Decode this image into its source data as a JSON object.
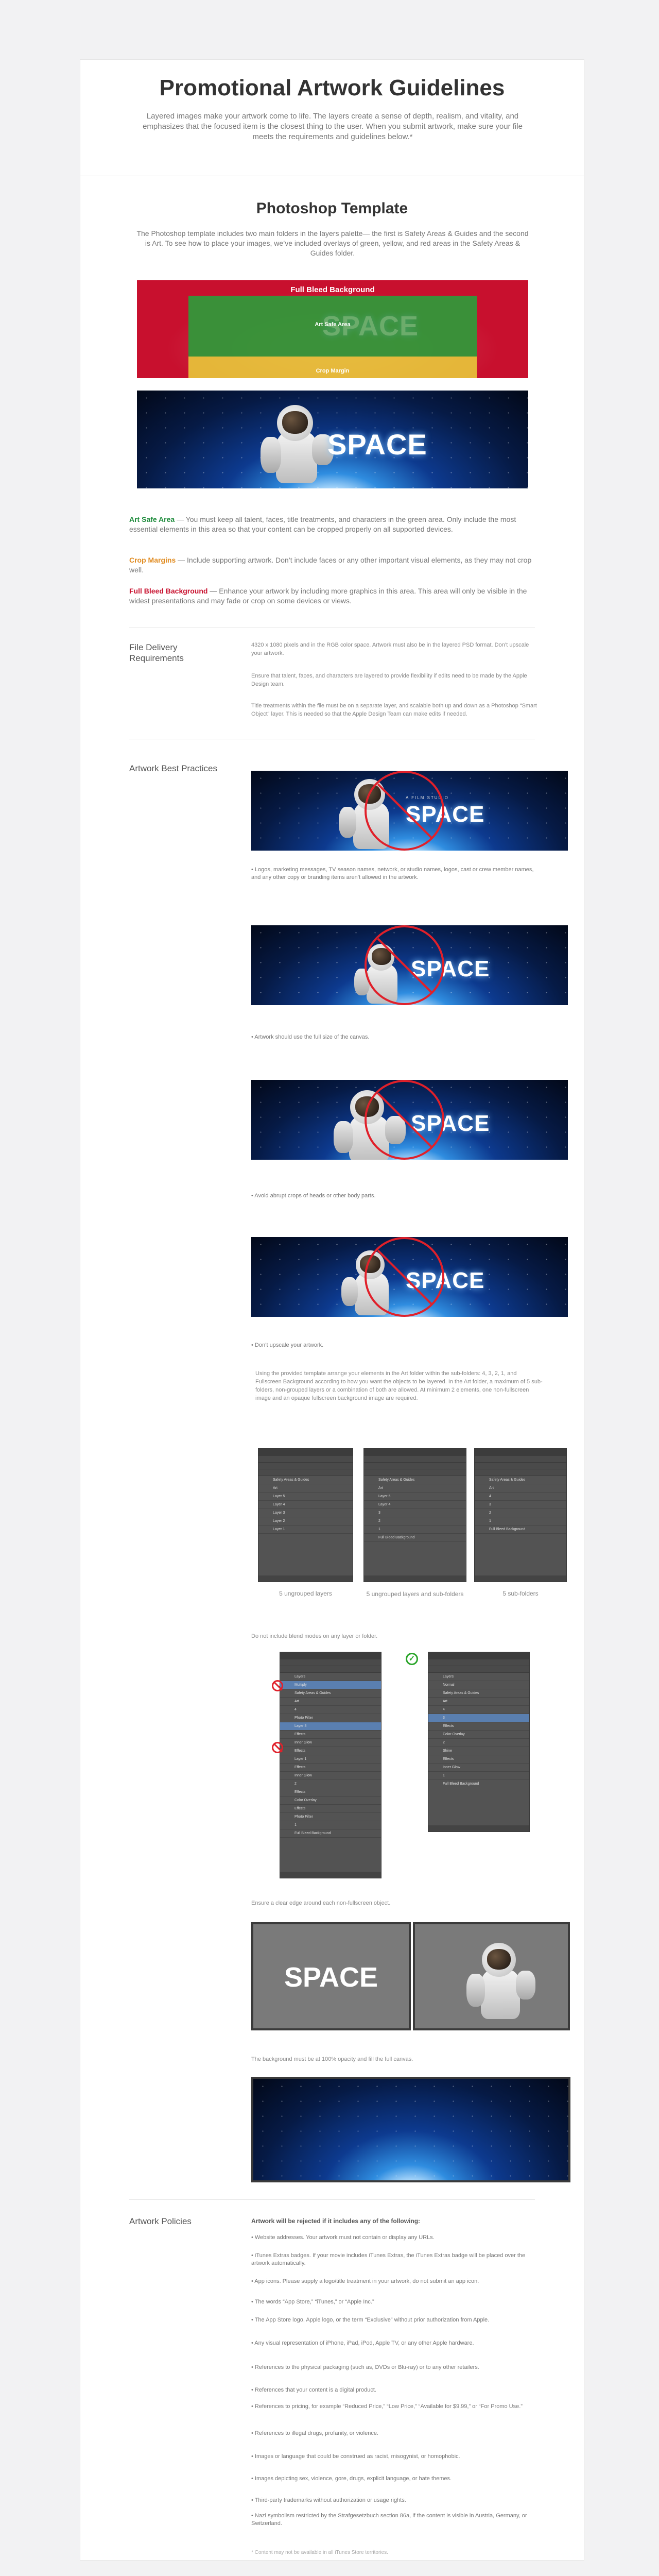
{
  "header": {
    "title": "Promotional Artwork Guidelines",
    "intro": "Layered images make your artwork come to life. The layers create a sense of depth, realism, and vitality, and emphasizes that the focused item is the closest thing to the user. When you submit artwork, make sure your file meets the requirements and guidelines below.*"
  },
  "template": {
    "title": "Photoshop Template",
    "intro": "The Photoshop template includes two main folders in the layers palette— the first is Safety Areas & Guides and the second is Art. To see how to place your images, we’ve included overlays of green, yellow, and red areas in the Safety Areas & Guides folder.",
    "overlay_labels": {
      "full_bleed": "Full Bleed Background",
      "art_safe": "Art Safe Area",
      "crop": "Crop Margin"
    },
    "space_word": "SPACE",
    "colors": {
      "red": "#c8102e",
      "yellow": "#e8c83a",
      "green": "#1c8a3a",
      "orange": "#e08a1e"
    },
    "areas": [
      {
        "name": "Art Safe Area",
        "text": " — You must keep all talent, faces, title treatments, and characters in the green area. Only include the most essential elements in this area so that your content can be cropped properly on all supported devices."
      },
      {
        "name": "Crop Margins",
        "text": " — Include supporting artwork. Don’t include faces or any other important visual elements, as they may not crop well."
      },
      {
        "name": "Full Bleed Background",
        "text": " — Enhance your artwork by including more graphics in this area. This area will only be visible in the widest presentations and may fade or crop on some devices or views."
      }
    ]
  },
  "file_delivery": {
    "title": "File Delivery Requirements",
    "paragraphs": [
      "4320 x 1080 pixels and in the RGB color space. Artwork must also be in the layered PSD format. Don’t upscale your artwork.",
      "Ensure that talent, faces, and characters are layered to provide flexibility if edits need to be made by the Apple Design team.",
      "Title treatments within the file must be on a separate layer, and scalable both up and down as a Photoshop “Smart Object” layer. This is needed so that the Apple Design Team can make edits if needed."
    ]
  },
  "best_practices": {
    "title": "Artwork Best Practices",
    "examples": [
      {
        "subtitle": "A FILM STUDIO",
        "caption": "• Logos, marketing messages, TV season names, network, or studio names, logos, cast or crew member names, and any other copy or branding items aren’t allowed in the artwork."
      },
      {
        "subtitle": "",
        "caption": "• Artwork should use the full size of the canvas."
      },
      {
        "subtitle": "",
        "caption": "• Avoid abrupt crops of heads or other body parts."
      },
      {
        "subtitle": "",
        "caption": "• Don’t upscale your artwork."
      }
    ],
    "layers_text": "Using the provided template arrange your elements in the Art folder within the sub-folders: 4, 3, 2, 1, and Fullscreen Background according to how you want the objects to be layered. In the Art folder, a maximum of 5 sub-folders, non-grouped layers or a combination of both are allowed. At minimum 2 elements, one non-fullscreen image and an opaque fullscreen background image are required.",
    "panels": [
      {
        "caption": "5 ungrouped layers",
        "rows": [
          "Safety Areas & Guides",
          "Art",
          "Layer 5",
          "Layer 4",
          "Layer 3",
          "Layer 2",
          "Layer 1"
        ]
      },
      {
        "caption": "5 ungrouped layers and sub-folders",
        "rows": [
          "Safety Areas & Guides",
          "Art",
          "Layer 5",
          "Layer 4",
          "3",
          "2",
          "1",
          "Full Bleed Background"
        ]
      },
      {
        "caption": "5 sub-folders",
        "rows": [
          "Safety Areas & Guides",
          "Art",
          "4",
          "3",
          "2",
          "1",
          "Full Bleed Background"
        ]
      }
    ],
    "blend_text": "Do not include blend modes on any layer or folder.",
    "blend_panels": {
      "bad_rows": [
        "Layers",
        "Multiply",
        "Safety Areas & Guides",
        "Art",
        "4",
        "Photo Filter",
        "Layer 3",
        "Effects",
        "Inner Glow",
        "Effects",
        "Layer 1",
        "Effects",
        "Inner Glow",
        "2",
        "Effects",
        "Color Overlay",
        "Effects",
        "Photo Filter",
        "1",
        "Full Bleed Background"
      ],
      "good_rows": [
        "Layers",
        "Normal",
        "Safety Areas & Guides",
        "Art",
        "4",
        "3",
        "Effects",
        "Color Overlay",
        "2",
        "Shine",
        "Effects",
        "Inner Glow",
        "1",
        "Full Bleed Background"
      ]
    },
    "clear_edge_text": "Ensure a clear edge around each non-fullscreen object.",
    "clear_edge_word": "SPACE",
    "bg_text": "The background must be at 100% opacity and fill the full canvas."
  },
  "policies": {
    "title": "Artwork Policies",
    "heading": "Artwork will be rejected if it includes any of the following:",
    "items": [
      "• Website addresses. Your artwork must not contain or display any URLs.",
      "• iTunes Extras badges. If your movie includes iTunes Extras, the iTunes Extras badge will be placed over the artwork automatically.",
      "• App icons. Please supply a logo/title treatment in your artwork, do not submit an app icon.",
      "• The words “App Store,” “iTunes,” or “Apple Inc.”",
      "• The App Store logo, Apple logo, or the term “Exclusive” without prior authorization from Apple.",
      "• Any visual representation of iPhone, iPad, iPod, Apple TV, or any other Apple hardware.",
      "• References to the physical packaging (such as, DVDs or Blu-ray) or to any other retailers.",
      "• References that your content is a digital product.",
      "• References to pricing, for example “Reduced Price,” “Low Price,” “Available for $9.99,” or “For Promo Use.”",
      "• References to illegal drugs, profanity, or violence.",
      "• Images or language that could be construed as racist, misogynist, or homophobic.",
      "• Images depicting sex, violence, gore, drugs, explicit language, or hate themes.",
      "• Third-party trademarks without authorization or usage rights.",
      "• Nazi symbolism restricted by the Strafgesetzbuch section 86a, if the content is visible in Austria, Germany, or Switzerland."
    ],
    "footnote": "* Content may not be available in all iTunes Store territories."
  }
}
